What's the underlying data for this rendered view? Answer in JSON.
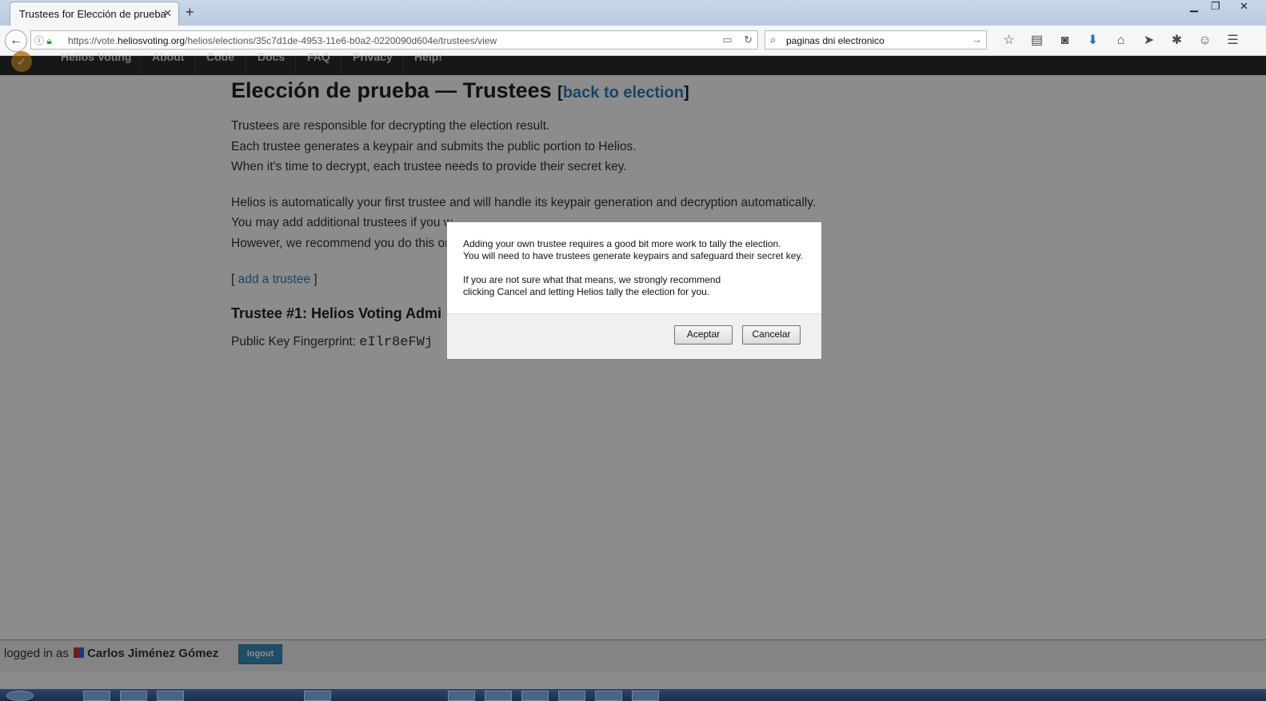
{
  "browser": {
    "tab_title": "Trustees for Elección de prueba",
    "tab_close": "✕",
    "new_tab": "+",
    "url_scheme": "https://vote.",
    "url_host": "heliosvoting.org",
    "url_path": "/helios/elections/35c7d1de-4953-11e6-b0a2-0220090d604e/trustees/view",
    "search_value": "paginas dni electronico"
  },
  "nav": {
    "items": [
      "Helios Voting",
      "About",
      "Code",
      "Docs",
      "FAQ",
      "Privacy",
      "Help!"
    ]
  },
  "main": {
    "title": "Elección de prueba — Trustees",
    "back_link": "back to election",
    "intro": [
      "Trustees are responsible for decrypting the election result.",
      "Each trustee generates a keypair and submits the public portion to Helios.",
      "When it's time to decrypt, each trustee needs to provide their secret key."
    ],
    "auto_line": "Helios is automatically your first trustee and will handle its keypair generation and decryption automatically.",
    "add_line_partial": "You may add additional trustees if you w",
    "however_partial": "However, we recommend you do this on",
    "add_trustee_link": "add a trustee",
    "trustee_heading": "Trustee #1: Helios Voting Admi",
    "fingerprint_label": "Public Key Fingerprint:",
    "fingerprint_value": "eIlr8eFWj"
  },
  "footer": {
    "logged_in_as": "logged in as",
    "user_name": "Carlos Jiménez Gómez",
    "logout_label": "logout"
  },
  "dialog": {
    "line1": "Adding your own trustee requires a good bit more work to tally the election.",
    "line2": "You will need to have trustees generate keypairs and safeguard their secret key.",
    "line3": "If you are not sure what that means, we strongly recommend",
    "line4": "clicking Cancel and letting Helios tally the election for you.",
    "ok_label": "Aceptar",
    "cancel_label": "Cancelar"
  }
}
